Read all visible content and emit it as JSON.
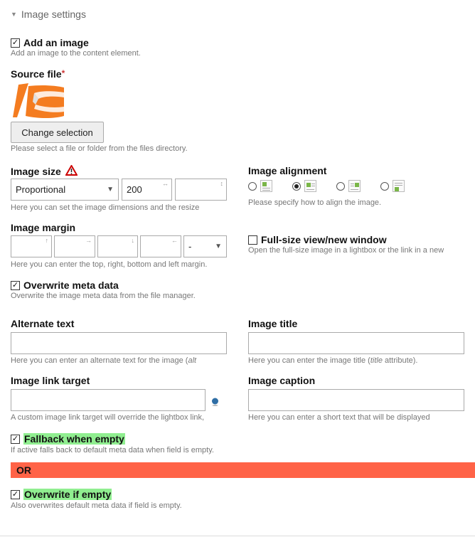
{
  "legend": {
    "title": "Image settings"
  },
  "add_image": {
    "label": "Add an image",
    "help": "Add an image to the content element.",
    "checked": true
  },
  "source_file": {
    "label": "Source file",
    "required_mark": "*",
    "button": "Change selection",
    "help": "Please select a file or folder from the files directory.",
    "thumbnail_icon": "contao-logo-thumbnail"
  },
  "image_size": {
    "label": "Image size",
    "warning_icon": "warning-icon",
    "mode": "Proportional",
    "width": "200",
    "height": "",
    "help": "Here you can set the image dimensions and the resize"
  },
  "image_alignment": {
    "label": "Image alignment",
    "help": "Please specify how to align the image.",
    "options": [
      {
        "name": "top",
        "selected": false
      },
      {
        "name": "left",
        "selected": true
      },
      {
        "name": "right",
        "selected": false
      },
      {
        "name": "bottom",
        "selected": false
      }
    ]
  },
  "image_margin": {
    "label": "Image margin",
    "unit": "-",
    "help": "Here you can enter the top, right, bottom and left margin."
  },
  "fullsize": {
    "label": "Full-size view/new window",
    "help": "Open the full-size image in a lightbox or the link in a new",
    "checked": false
  },
  "overwrite_meta": {
    "label": "Overwrite meta data",
    "help": "Overwrite the image meta data from the file manager.",
    "checked": true
  },
  "alt_text": {
    "label": "Alternate text",
    "value": "",
    "help_prefix": "Here you can enter an alternate text for the image (",
    "help_em": "alt"
  },
  "image_title": {
    "label": "Image title",
    "value": "",
    "help_prefix": "Here you can enter the image title (",
    "help_em": "title",
    "help_suffix": " attribute)."
  },
  "link_target": {
    "label": "Image link target",
    "value": "",
    "help": "A custom image link target will override the lightbox link,",
    "picker_icon": "globe-icon"
  },
  "caption": {
    "label": "Image caption",
    "value": "",
    "help": "Here you can enter a short text that will be displayed"
  },
  "fallback": {
    "label": "Fallback when empty",
    "help": "If active falls back to default meta data when field is empty.",
    "checked": true
  },
  "or_bar": {
    "text": "OR",
    "color": "#ff6347"
  },
  "overwrite_empty": {
    "label": "Overwrite if empty",
    "help": "Also overwrites default meta data if field is empty.",
    "checked": true
  }
}
